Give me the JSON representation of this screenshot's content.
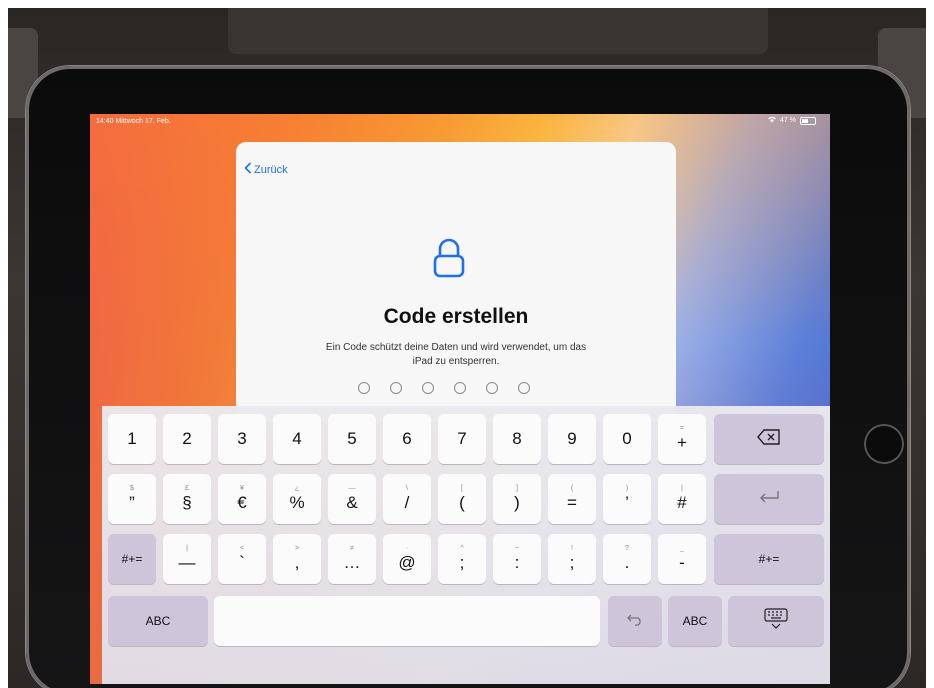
{
  "status_bar": {
    "time_date": "14:40  Mittwoch 17. Feb.",
    "battery": "47 %"
  },
  "sheet": {
    "back_label": "Zurück",
    "title": "Code erstellen",
    "description_line1": "Ein Code schützt deine Daten und wird verwendet, um das",
    "description_line2": "iPad zu entsperren.",
    "passcode_length": 6
  },
  "keyboard": {
    "row1": [
      {
        "main": "1",
        "hint": ""
      },
      {
        "main": "2",
        "hint": ""
      },
      {
        "main": "3",
        "hint": ""
      },
      {
        "main": "4",
        "hint": ""
      },
      {
        "main": "5",
        "hint": ""
      },
      {
        "main": "6",
        "hint": ""
      },
      {
        "main": "7",
        "hint": ""
      },
      {
        "main": "8",
        "hint": ""
      },
      {
        "main": "9",
        "hint": ""
      },
      {
        "main": "0",
        "hint": ""
      },
      {
        "main": "+",
        "hint": "="
      }
    ],
    "row2": [
      {
        "main": "”",
        "hint": "$"
      },
      {
        "main": "§",
        "hint": "£"
      },
      {
        "main": "€",
        "hint": "¥"
      },
      {
        "main": "%",
        "hint": "¿"
      },
      {
        "main": "&",
        "hint": "—"
      },
      {
        "main": "/",
        "hint": "\\"
      },
      {
        "main": "(",
        "hint": "["
      },
      {
        "main": ")",
        "hint": "]"
      },
      {
        "main": "=",
        "hint": "("
      },
      {
        "main": "’",
        "hint": ")"
      },
      {
        "main": "#",
        "hint": "|"
      }
    ],
    "row3_left": "#+=",
    "row3": [
      {
        "main": "—",
        "hint": "|"
      },
      {
        "main": "`",
        "hint": "<"
      },
      {
        "main": "‚",
        "hint": ">"
      },
      {
        "main": "…",
        "hint": "≠"
      },
      {
        "main": "@",
        "hint": "·"
      },
      {
        "main": ";",
        "hint": "^"
      },
      {
        "main": ":",
        "hint": "~"
      },
      {
        "main": ";",
        "hint": "!"
      },
      {
        "main": ".",
        "hint": "?"
      },
      {
        "main": "-",
        "hint": "_"
      }
    ],
    "row3_right": "#+=",
    "abc_left": "ABC",
    "abc_right": "ABC",
    "colors": {
      "key": "#fbfbfc",
      "dark_key": "#cec5db",
      "accent": "#1e6ef0"
    }
  }
}
